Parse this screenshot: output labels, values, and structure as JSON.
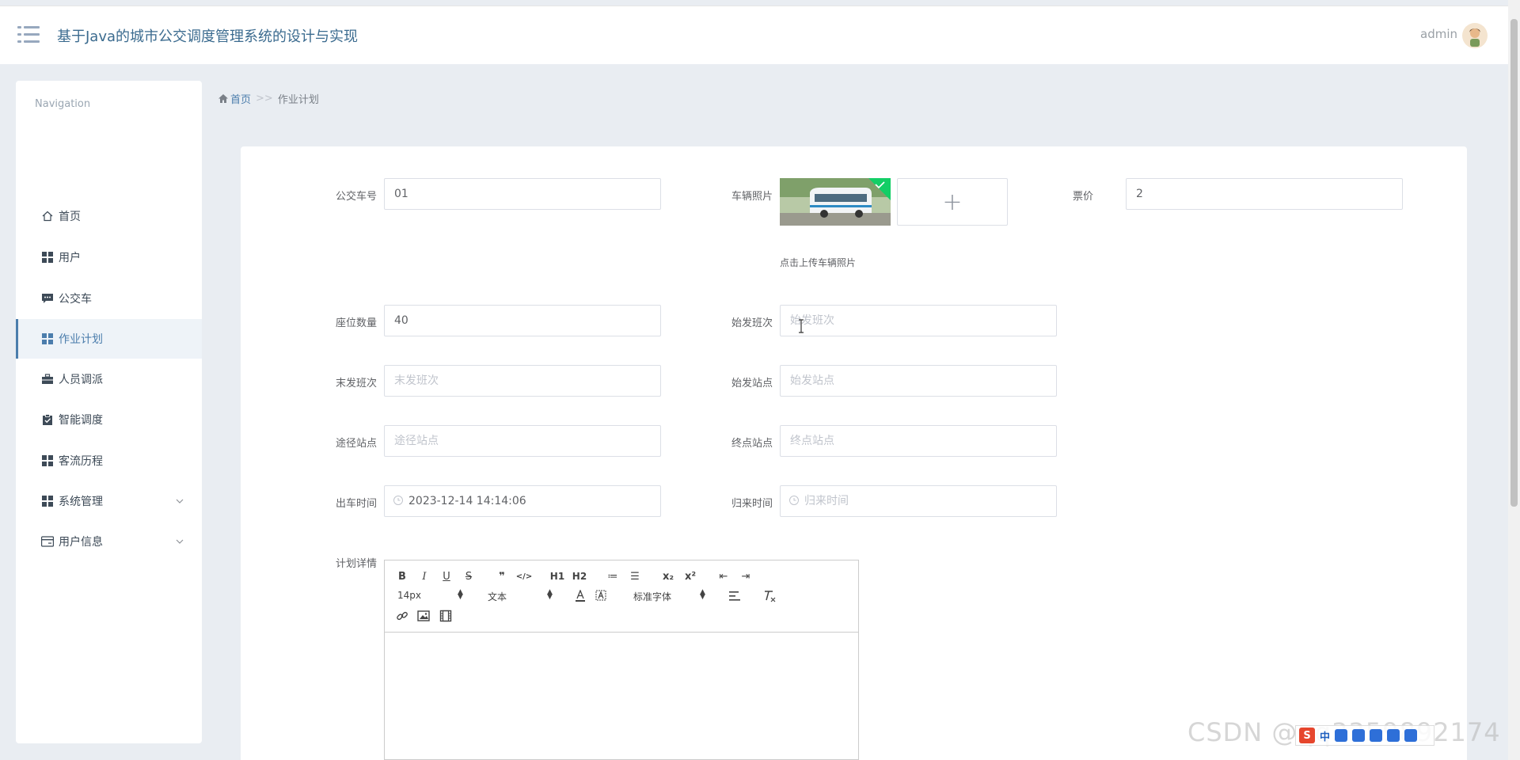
{
  "header": {
    "title": "基于Java的城市公交调度管理系统的设计与实现",
    "username": "admin"
  },
  "sidebar": {
    "caption": "Navigation",
    "items": [
      {
        "label": "首页",
        "icon": "home-icon"
      },
      {
        "label": "用户",
        "icon": "grid-icon"
      },
      {
        "label": "公交车",
        "icon": "comment-icon"
      },
      {
        "label": "作业计划",
        "icon": "grid-icon",
        "active": true
      },
      {
        "label": "人员调派",
        "icon": "briefcase-icon"
      },
      {
        "label": "智能调度",
        "icon": "clipboard-check-icon"
      },
      {
        "label": "客流历程",
        "icon": "grid-icon"
      },
      {
        "label": "系统管理",
        "icon": "grid-icon",
        "expandable": true
      },
      {
        "label": "用户信息",
        "icon": "card-icon",
        "expandable": true
      }
    ]
  },
  "breadcrumb": {
    "home": "首页",
    "separator": ">>",
    "current": "作业计划"
  },
  "form": {
    "bus_no": {
      "label": "公交车号",
      "value": "01"
    },
    "photo": {
      "label": "车辆照片",
      "tip": "点击上传车辆照片",
      "add": "+"
    },
    "fare": {
      "label": "票价",
      "value": "2"
    },
    "seats": {
      "label": "座位数量",
      "value": "40"
    },
    "first_trip": {
      "label": "始发班次",
      "placeholder": "始发班次"
    },
    "last_trip": {
      "label": "末发班次",
      "placeholder": "末发班次"
    },
    "origin": {
      "label": "始发站点",
      "placeholder": "始发站点"
    },
    "via": {
      "label": "途径站点",
      "placeholder": "途径站点"
    },
    "terminal": {
      "label": "终点站点",
      "placeholder": "终点站点"
    },
    "depart_time": {
      "label": "出车时间",
      "value": "2023-12-14 14:14:06"
    },
    "return_time": {
      "label": "归来时间",
      "placeholder": "归来时间"
    },
    "detail": {
      "label": "计划详情"
    }
  },
  "editor": {
    "font_size": "14px",
    "text_type": "文本",
    "font_family": "标准字体",
    "buttons": [
      "B",
      "I",
      "U",
      "S",
      "❞",
      "</>",
      "H1",
      "H2",
      "≔",
      "☰",
      "x₂",
      "x²",
      "⇤",
      "⇥"
    ]
  },
  "watermark": "CSDN @qq3359892174"
}
